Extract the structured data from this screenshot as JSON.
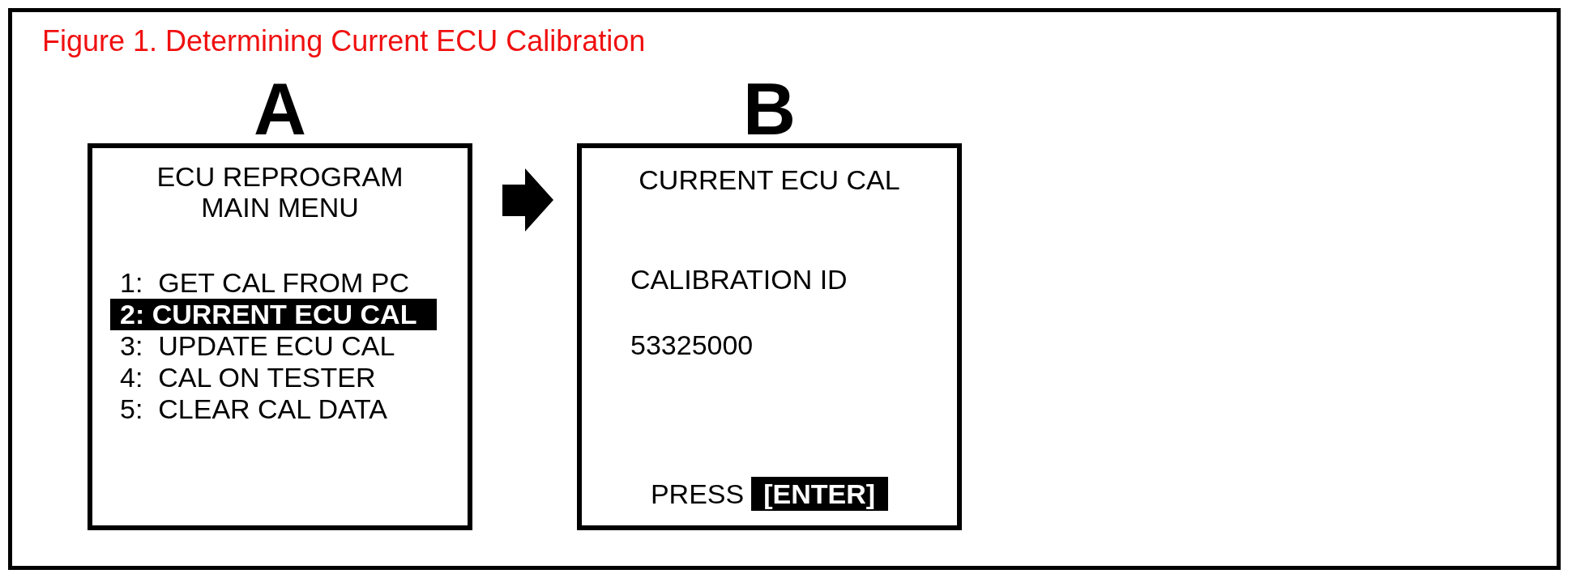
{
  "figure": {
    "title": "Figure 1. Determining Current ECU Calibration"
  },
  "panels": [
    {
      "kind": "menu",
      "label": "A",
      "title_lines": [
        "ECU REPROGRAM",
        "MAIN MENU"
      ],
      "items": [
        {
          "text": "1:  GET CAL FROM PC",
          "selected": false
        },
        {
          "text": "2: CURRENT ECU CAL",
          "selected": true
        },
        {
          "text": "3:  UPDATE ECU CAL",
          "selected": false
        },
        {
          "text": "4:  CAL ON TESTER",
          "selected": false
        },
        {
          "text": "5:  CLEAR CAL DATA",
          "selected": false
        }
      ]
    },
    {
      "kind": "readout",
      "label": "B",
      "title_lines": [
        "CURRENT ECU CAL"
      ],
      "field_label": "CALIBRATION ID",
      "value": "53325000",
      "prompt": {
        "text": "PRESS",
        "key": "[ENTER]"
      }
    }
  ]
}
